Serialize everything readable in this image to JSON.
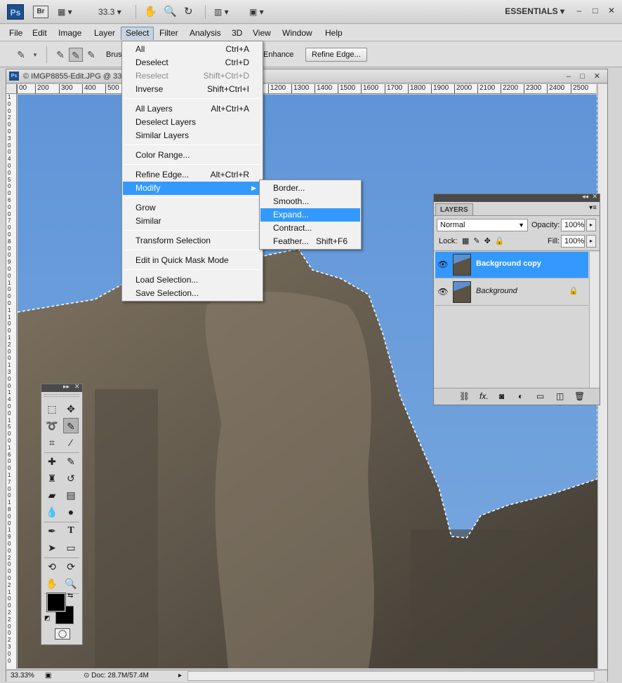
{
  "appbar": {
    "ps_logo": "Ps",
    "br_logo": "Br",
    "zoom": "33.3",
    "workspace": "ESSENTIALS",
    "minimize": "–",
    "maximize": "□",
    "close": "✕"
  },
  "menubar": [
    "File",
    "Edit",
    "Image",
    "Layer",
    "Select",
    "Filter",
    "Analysis",
    "3D",
    "View",
    "Window",
    "Help"
  ],
  "options_bar": {
    "brush_label": "Brus",
    "enhance_label": "Enhance",
    "refine_edge_button": "Refine Edge..."
  },
  "document": {
    "title": "© IMGP8855-Edit.JPG @ 33",
    "ruler_h": [
      "00",
      "200",
      "300",
      "400",
      "500",
      "1200",
      "1300",
      "1400",
      "1500",
      "1600",
      "1700",
      "1800",
      "1900",
      "2000",
      "2100",
      "2200",
      "2300",
      "2400",
      "2500"
    ],
    "ruler_v": [
      "1",
      "0",
      "0",
      "2",
      "0",
      "0",
      "3",
      "0",
      "0",
      "4",
      "0",
      "0",
      "5",
      "0",
      "0",
      "6",
      "0",
      "0",
      "7",
      "0",
      "0",
      "8",
      "0",
      "0",
      "9",
      "0",
      "0",
      "1",
      "0",
      "0",
      "0",
      "1",
      "1",
      "0",
      "0",
      "1",
      "2",
      "0",
      "0",
      "1",
      "3",
      "0",
      "0",
      "1",
      "4",
      "0",
      "0",
      "1",
      "5",
      "0",
      "0",
      "1",
      "6",
      "0",
      "0",
      "1",
      "7",
      "0",
      "0",
      "1",
      "8",
      "0",
      "0",
      "1",
      "9",
      "0",
      "0",
      "2",
      "0",
      "0",
      "0",
      "2",
      "1",
      "0",
      "0",
      "2",
      "2",
      "0",
      "0",
      "2",
      "3",
      "0",
      "0"
    ],
    "zoom_status": "33.33%",
    "doc_info": "Doc: 28.7M/57.4M"
  },
  "select_menu": {
    "items": [
      {
        "label": "All",
        "shortcut": "Ctrl+A"
      },
      {
        "label": "Deselect",
        "shortcut": "Ctrl+D"
      },
      {
        "label": "Reselect",
        "shortcut": "Shift+Ctrl+D"
      },
      {
        "label": "Inverse",
        "shortcut": "Shift+Ctrl+I"
      },
      {
        "label": "All Layers",
        "shortcut": "Alt+Ctrl+A"
      },
      {
        "label": "Deselect Layers",
        "shortcut": ""
      },
      {
        "label": "Similar Layers",
        "shortcut": ""
      },
      {
        "label": "Color Range...",
        "shortcut": ""
      },
      {
        "label": "Refine Edge...",
        "shortcut": "Alt+Ctrl+R"
      },
      {
        "label": "Modify",
        "shortcut": ""
      },
      {
        "label": "Grow",
        "shortcut": ""
      },
      {
        "label": "Similar",
        "shortcut": ""
      },
      {
        "label": "Transform Selection",
        "shortcut": ""
      },
      {
        "label": "Edit in Quick Mask Mode",
        "shortcut": ""
      },
      {
        "label": "Load Selection...",
        "shortcut": ""
      },
      {
        "label": "Save Selection...",
        "shortcut": ""
      }
    ]
  },
  "modify_submenu": {
    "items": [
      {
        "label": "Border...",
        "shortcut": ""
      },
      {
        "label": "Smooth...",
        "shortcut": ""
      },
      {
        "label": "Expand...",
        "shortcut": ""
      },
      {
        "label": "Contract...",
        "shortcut": ""
      },
      {
        "label": "Feather...",
        "shortcut": "Shift+F6"
      }
    ]
  },
  "layers_panel": {
    "tab": "LAYERS",
    "blend_mode": "Normal",
    "opacity_label": "Opacity:",
    "opacity_value": "100%",
    "lock_label": "Lock:",
    "fill_label": "Fill:",
    "fill_value": "100%",
    "layers": [
      {
        "name": "Background copy",
        "selected": true
      },
      {
        "name": "Background",
        "selected": false
      }
    ],
    "footer_fx": "fx."
  },
  "tools_panel": {
    "type_tool": "T"
  },
  "colors": {
    "highlight": "#3399ff",
    "sky": "#6f9fd8",
    "stone": "#5b5243"
  }
}
